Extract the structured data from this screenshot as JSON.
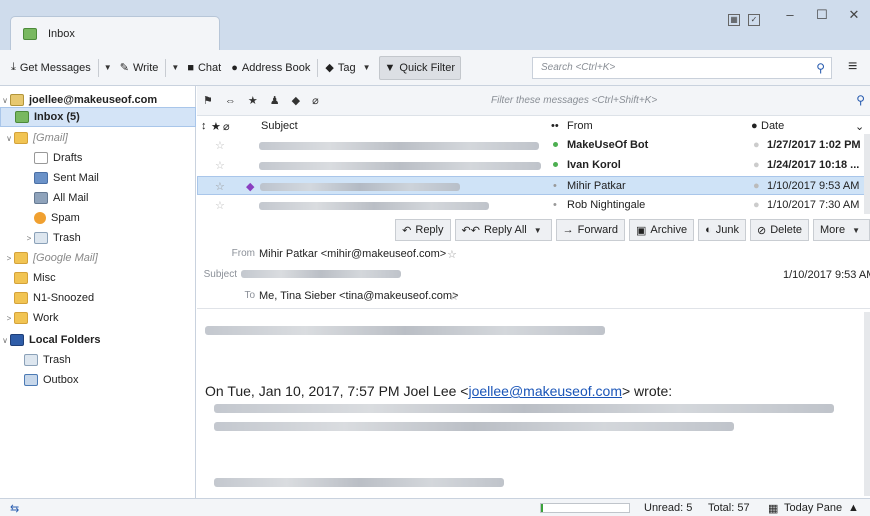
{
  "titlebar": {
    "tab_label": "Inbox",
    "window_controls": {
      "minimize": "–",
      "maximize": "☐",
      "close": "✕"
    }
  },
  "toolbar": {
    "get_messages": "Get Messages",
    "write": "Write",
    "chat": "Chat",
    "address_book": "Address Book",
    "tag": "Tag",
    "quick_filter": "Quick Filter",
    "search_placeholder": "Search <Ctrl+K>"
  },
  "folders": {
    "account": "joellee@makeuseof.com",
    "items": [
      {
        "label": "Inbox (5)",
        "icon": "inbox-icon"
      },
      {
        "label": "[Gmail]",
        "icon": "folder-icon"
      },
      {
        "label": "Drafts",
        "icon": "drafts-icon"
      },
      {
        "label": "Sent Mail",
        "icon": "sent-icon"
      },
      {
        "label": "All Mail",
        "icon": "archive-icon"
      },
      {
        "label": "Spam",
        "icon": "spam-icon"
      },
      {
        "label": "Trash",
        "icon": "trash-icon"
      },
      {
        "label": "[Google Mail]",
        "icon": "folder-icon"
      },
      {
        "label": "Misc",
        "icon": "folder-icon"
      },
      {
        "label": "N1-Snoozed",
        "icon": "folder-icon"
      },
      {
        "label": "Work",
        "icon": "folder-icon"
      },
      {
        "label": "Local Folders",
        "icon": "local-folders-icon"
      },
      {
        "label": "Trash",
        "icon": "trash-icon"
      },
      {
        "label": "Outbox",
        "icon": "outbox-icon"
      }
    ]
  },
  "thread_pane": {
    "filter_placeholder": "Filter these messages <Ctrl+Shift+K>",
    "columns": {
      "subject": "Subject",
      "from": "From",
      "date": "Date"
    },
    "rows": [
      {
        "from": "MakeUseOf Bot",
        "date": "1/27/2017 1:02 PM",
        "unread": true
      },
      {
        "from": "Ivan Korol",
        "date": "1/24/2017 10:18 ...",
        "unread": true
      },
      {
        "from": "Mihir Patkar",
        "date": "1/10/2017 9:53 AM",
        "unread": false
      },
      {
        "from": "Rob Nightingale",
        "date": "1/10/2017 7:30 AM",
        "unread": false
      }
    ]
  },
  "message": {
    "actions": {
      "reply": "Reply",
      "reply_all": "Reply All",
      "forward": "Forward",
      "archive": "Archive",
      "junk": "Junk",
      "delete": "Delete",
      "more": "More"
    },
    "from_label": "From",
    "from_value": "Mihir Patkar <mihir@makeuseof.com>",
    "subject_label": "Subject",
    "date": "1/10/2017 9:53 AM",
    "to_label": "To",
    "to_value": "Me, Tina Sieber <tina@makeuseof.com>",
    "quote_prefix": "On Tue, Jan 10, 2017, 7:57 PM Joel Lee <",
    "quote_link": "joellee@makeuseof.com",
    "quote_suffix": "> wrote:"
  },
  "statusbar": {
    "unread": "Unread: 5",
    "total": "Total: 57",
    "today_pane": "Today Pane",
    "progress": 0.02
  },
  "colors": {
    "accent": "#2a5db0",
    "selection": "#cfe3f7",
    "unread_dot": "#4caf50"
  }
}
